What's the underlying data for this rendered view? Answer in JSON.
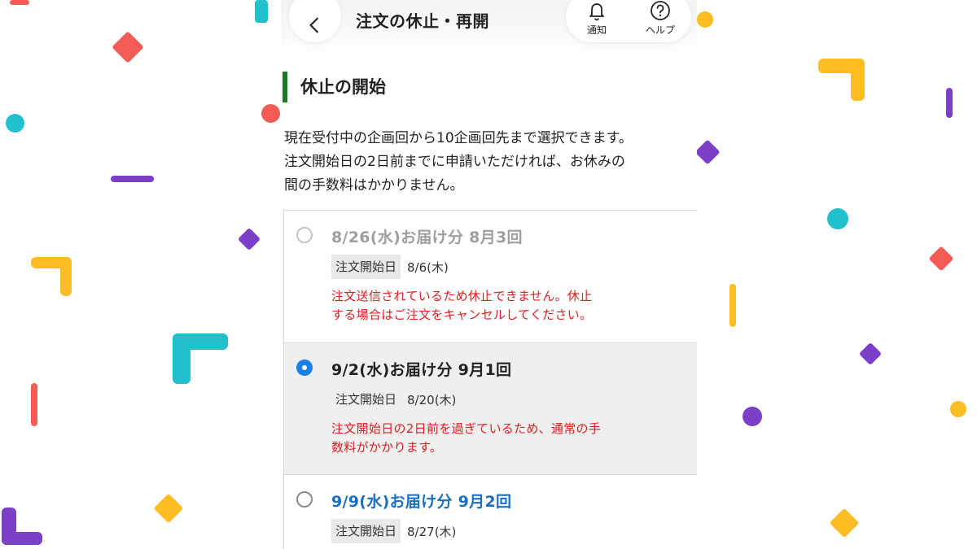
{
  "header": {
    "title": "注文の休止・再開",
    "notify_label": "通知",
    "help_label": "ヘルプ"
  },
  "section": {
    "title": "休止の開始",
    "description_line1": "現在受付中の企画回から10企画回先まで選択できます。",
    "description_line2": "注文開始日の2日前までに申請いただければ、お休みの",
    "description_line3": "間の手数料はかかりません。"
  },
  "options": [
    {
      "title": "8/26(水)お届け分 8月3回",
      "date_label": "注文開始日",
      "date_value": "8/6(木)",
      "warning_line1": "注文送信されているため休止できません。休止",
      "warning_line2": "する場合はご注文をキャンセルしてください。",
      "state": "disabled"
    },
    {
      "title": "9/2(水)お届け分 9月1回",
      "date_label": "注文開始日",
      "date_value": "8/20(木)",
      "warning_line1": "注文開始日の2日前を過ぎているため、通常の手",
      "warning_line2": "数料がかかります。",
      "state": "selected"
    },
    {
      "title": "9/9(水)お届け分 9月2回",
      "date_label": "注文開始日",
      "date_value": "8/27(木)",
      "state": "unselected"
    }
  ],
  "colors": {
    "accent_green": "#1a7a26",
    "radio_blue": "#1a7fe6",
    "link_blue": "#1a6fc4",
    "warning_red": "#d92020",
    "confetti_red": "#f25c54",
    "confetti_teal": "#20c0cc",
    "confetti_yellow": "#fbbd23",
    "confetti_purple": "#7c3fc8"
  },
  "icons": {
    "back": "chevron-left-icon",
    "notify": "bell-icon",
    "help": "question-circle-icon"
  }
}
